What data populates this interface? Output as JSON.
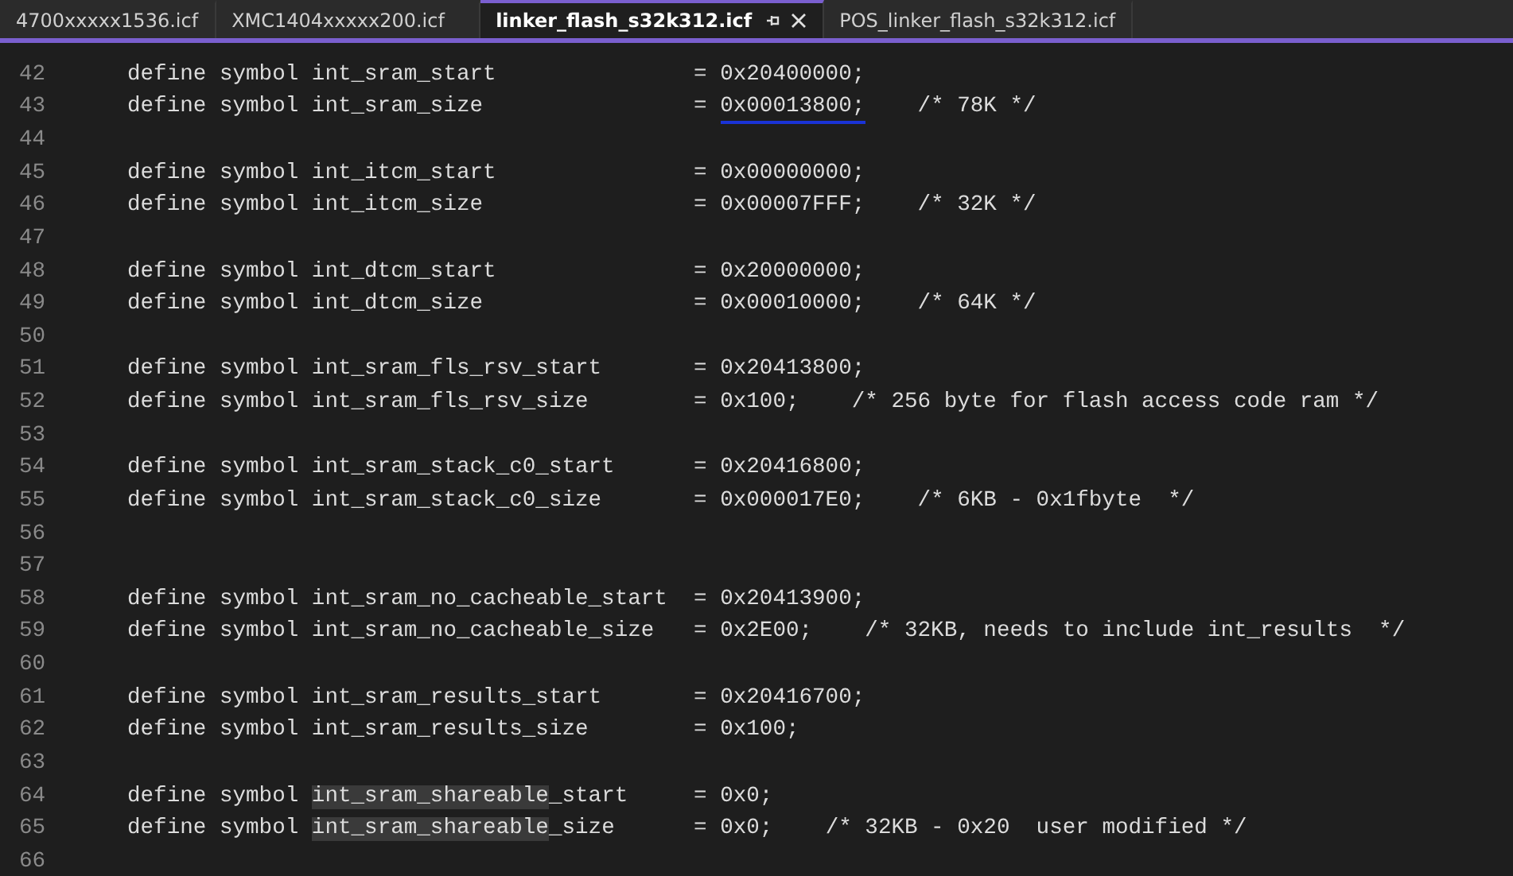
{
  "tabs": [
    {
      "label": "4700xxxxx1536.icf",
      "selected": false
    },
    {
      "label": "XMC1404xxxxx200.icf",
      "selected": false
    },
    {
      "label": "linker_flash_s32k312.icf",
      "selected": true
    },
    {
      "label": "POS_linker_flash_s32k312.icf",
      "selected": false
    }
  ],
  "lines": [
    {
      "number": "42",
      "segments": [
        {
          "kind": "plain",
          "text": "define symbol int_sram_start               = 0x20400000;"
        }
      ]
    },
    {
      "number": "43",
      "segments": [
        {
          "kind": "plain",
          "text": "define symbol int_sram_size                = "
        },
        {
          "kind": "underline",
          "text": "0x00013800;"
        },
        {
          "kind": "plain",
          "text": "    /* 78K */"
        }
      ]
    },
    {
      "number": "44"
    },
    {
      "number": "45",
      "segments": [
        {
          "kind": "plain",
          "text": "define symbol int_itcm_start               = 0x00000000;"
        }
      ]
    },
    {
      "number": "46",
      "segments": [
        {
          "kind": "plain",
          "text": "define symbol int_itcm_size                = 0x00007FFF;    /* 32K */"
        }
      ]
    },
    {
      "number": "47"
    },
    {
      "number": "48",
      "segments": [
        {
          "kind": "plain",
          "text": "define symbol int_dtcm_start               = 0x20000000;"
        }
      ]
    },
    {
      "number": "49",
      "segments": [
        {
          "kind": "plain",
          "text": "define symbol int_dtcm_size                = 0x00010000;    /* 64K */"
        }
      ]
    },
    {
      "number": "50"
    },
    {
      "number": "51",
      "segments": [
        {
          "kind": "plain",
          "text": "define symbol int_sram_fls_rsv_start       = 0x20413800;"
        }
      ]
    },
    {
      "number": "52",
      "segments": [
        {
          "kind": "plain",
          "text": "define symbol int_sram_fls_rsv_size        = 0x100;    /* 256 byte for flash access code ram */"
        }
      ]
    },
    {
      "number": "53"
    },
    {
      "number": "54",
      "segments": [
        {
          "kind": "plain",
          "text": "define symbol int_sram_stack_c0_start      = 0x20416800;"
        }
      ]
    },
    {
      "number": "55",
      "segments": [
        {
          "kind": "plain",
          "text": "define symbol int_sram_stack_c0_size       = 0x000017E0;    /* 6KB - 0x1fbyte  */"
        }
      ]
    },
    {
      "number": "56"
    },
    {
      "number": "57"
    },
    {
      "number": "58",
      "segments": [
        {
          "kind": "plain",
          "text": "define symbol int_sram_no_cacheable_start  = 0x20413900;"
        }
      ]
    },
    {
      "number": "59",
      "segments": [
        {
          "kind": "plain",
          "text": "define symbol int_sram_no_cacheable_size   = 0x2E00;    /* 32KB, needs to include int_results  */"
        }
      ]
    },
    {
      "number": "60"
    },
    {
      "number": "61",
      "segments": [
        {
          "kind": "plain",
          "text": "define symbol int_sram_results_start       = 0x20416700;"
        }
      ]
    },
    {
      "number": "62",
      "segments": [
        {
          "kind": "plain",
          "text": "define symbol int_sram_results_size        = 0x100;"
        }
      ]
    },
    {
      "number": "63"
    },
    {
      "number": "64",
      "segments": [
        {
          "kind": "plain",
          "text": "define symbol "
        },
        {
          "kind": "highlight",
          "text": "int_sram_shareable"
        },
        {
          "kind": "plain",
          "text": "_start     = 0x0;"
        }
      ]
    },
    {
      "number": "65",
      "segments": [
        {
          "kind": "plain",
          "text": "define symbol "
        },
        {
          "kind": "highlight",
          "text": "int_sram_shareable"
        },
        {
          "kind": "plain",
          "text": "_size      = 0x0;    /* 32KB - 0x20  user modified */"
        }
      ]
    },
    {
      "number": "66"
    }
  ]
}
